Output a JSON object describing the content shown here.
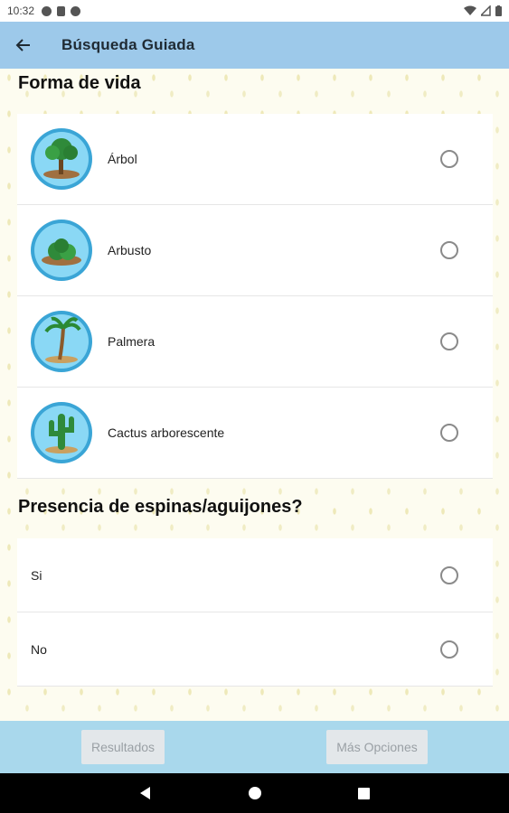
{
  "status_bar": {
    "time": "10:32"
  },
  "app_bar": {
    "title": "Búsqueda Guiada",
    "back_icon": "arrow-left-icon"
  },
  "sections": {
    "forma_de_vida": {
      "title": "Forma de vida",
      "options": [
        {
          "label": "Árbol",
          "icon": "tree-icon",
          "selected": false
        },
        {
          "label": "Arbusto",
          "icon": "shrub-icon",
          "selected": false
        },
        {
          "label": "Palmera",
          "icon": "palm-icon",
          "selected": false
        },
        {
          "label": "Cactus arborescente",
          "icon": "cactus-icon",
          "selected": false
        }
      ]
    },
    "espinas": {
      "title": "Presencia de espinas/aguijones?",
      "options": [
        {
          "label": "Si",
          "selected": false
        },
        {
          "label": "No",
          "selected": false
        }
      ]
    }
  },
  "bottom_bar": {
    "results_label": "Resultados",
    "more_options_label": "Más Opciones"
  },
  "colors": {
    "app_bar": "#9dc9ea",
    "bottom_bar": "#a9d8ec",
    "icon_sky": "#6ecbf0"
  }
}
